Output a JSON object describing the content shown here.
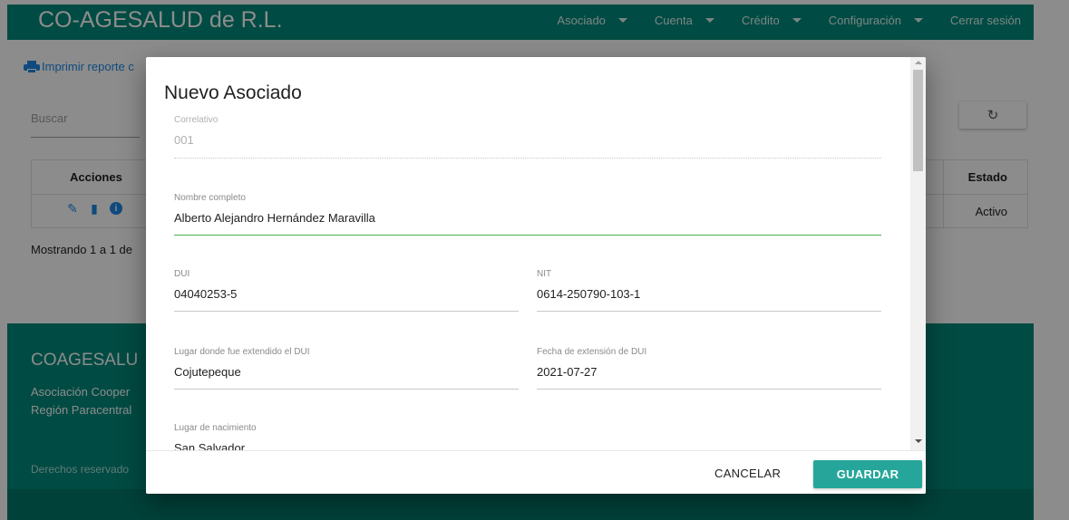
{
  "app": {
    "brand": "CO-AGESALUD de R.L."
  },
  "nav": [
    {
      "label": "Asociado",
      "has_dropdown": true
    },
    {
      "label": "Cuenta",
      "has_dropdown": true
    },
    {
      "label": "Crédito",
      "has_dropdown": true
    },
    {
      "label": "Configuración",
      "has_dropdown": true
    },
    {
      "label": "Cerrar sesión",
      "has_dropdown": false
    }
  ],
  "background": {
    "print_link": "Imprimir reporte c",
    "search_placeholder": "Buscar",
    "refresh_icon": "↻",
    "table": {
      "col_actions": "Acciones",
      "col_status": "Estado",
      "row_status": "Activo",
      "row_icons": [
        "edit-icon",
        "delete-icon",
        "info-icon"
      ]
    },
    "showing": "Mostrando 1 a 1 de",
    "footer": {
      "title": "COAGESALU",
      "line1": "Asociación Cooper",
      "line2": "Región Paracentral",
      "copyright": "Derechos reservado"
    }
  },
  "dialog": {
    "title": "Nuevo Asociado",
    "fields": {
      "correlativo": {
        "label": "Correlativo",
        "value": "001"
      },
      "nombre": {
        "label": "Nombre completo",
        "value": "Alberto Alejandro Hernández Maravilla"
      },
      "dui": {
        "label": "DUI",
        "value": "04040253-5"
      },
      "nit": {
        "label": "NIT",
        "value": "0614-250790-103-1"
      },
      "lugar_dui": {
        "label": "Lugar donde fue extendido el DUI",
        "value": "Cojutepeque"
      },
      "fecha_dui": {
        "label": "Fecha de extensión de DUI",
        "value": "2021-07-27"
      },
      "lugar_nacimiento": {
        "label": "Lugar de nacimiento",
        "value": "San Salvador"
      }
    },
    "cancel_label": "CANCELAR",
    "save_label": "GUARDAR"
  },
  "colors": {
    "primary": "#00897b",
    "accent": "#26a69a",
    "link": "#1e88e5",
    "focus": "#4caf50"
  }
}
